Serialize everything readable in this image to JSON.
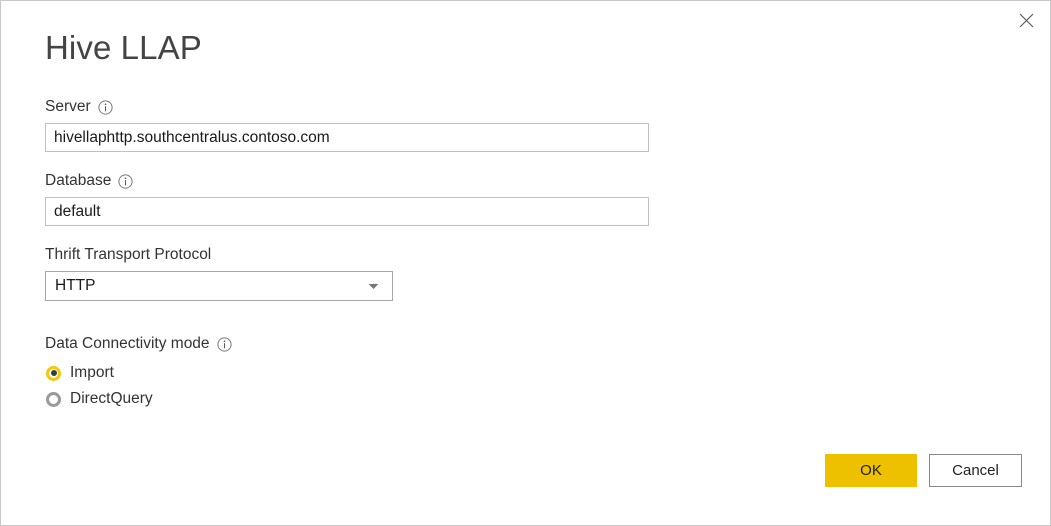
{
  "window": {
    "title": "Hive LLAP",
    "close_icon": "close-icon"
  },
  "form": {
    "server": {
      "label": "Server",
      "info_icon": "info-icon",
      "value": "hivellaphttp.southcentralus.contoso.com",
      "placeholder": ""
    },
    "database": {
      "label": "Database",
      "info_icon": "info-icon",
      "value": "default",
      "placeholder": ""
    },
    "thrift_transport_protocol": {
      "label": "Thrift Transport Protocol",
      "value": "HTTP",
      "chevron_icon": "chevron-down-icon",
      "options": [
        "HTTP"
      ]
    },
    "data_connectivity_mode": {
      "label": "Data Connectivity mode",
      "info_icon": "info-icon",
      "selected": "Import",
      "options": [
        {
          "label": "Import",
          "selected": true
        },
        {
          "label": "DirectQuery",
          "selected": false
        }
      ]
    }
  },
  "footer": {
    "ok_label": "OK",
    "cancel_label": "Cancel"
  },
  "colors": {
    "accent": "#eec100",
    "radio_selected_ring": "#f2c811",
    "radio_unselected_ring": "#9a9a9a",
    "title_text": "#444444",
    "body_text": "#333333",
    "input_border": "#c0c0c0",
    "window_border": "#c8c8c8",
    "button_border": "#8a8886"
  }
}
